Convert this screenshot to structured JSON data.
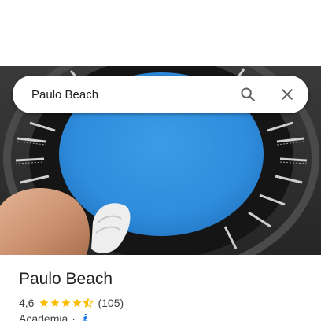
{
  "search": {
    "query": "Paulo Beach"
  },
  "icons": {
    "search": "search-icon",
    "close": "close-icon",
    "star": "star-icon",
    "half_star": "half-star-icon",
    "walk": "walking-person-icon"
  },
  "place": {
    "name": "Paulo Beach",
    "rating": "4,6",
    "rating_fraction": 0.92,
    "stars_filled": 4.5,
    "review_count": "(105)",
    "category": "Academia",
    "separator": "·"
  },
  "colors": {
    "star": "#fbbc04",
    "walk_icon": "#1a73e8",
    "trampoline_mat": "#2f8ddd",
    "text_primary": "#202124",
    "text_secondary": "#3c4043",
    "icon_gray": "#5f6368"
  }
}
